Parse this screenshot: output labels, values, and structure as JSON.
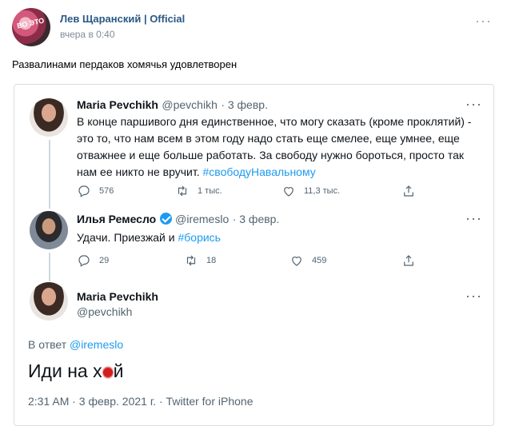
{
  "vk_post": {
    "author": "Лев Щаранский | Official",
    "time": "вчера в 0:40",
    "more": "···",
    "text": "Развалинами пердаков хомячья удовлетворен"
  },
  "thread": {
    "tweet1": {
      "name": "Maria Pevchikh",
      "handle": "@pevchikh",
      "date": "· 3 февр.",
      "text": "В конце паршивого дня единственное, что могу сказать (кроме проклятий) - это то, что нам всем в этом году надо стать еще смелее, еще умнее, еще отважнее и еще больше работать. За свободу нужно бороться, просто так нам ее никто не вручит.",
      "hashtag": "#свободуНавальному",
      "replies": "576",
      "retweets": "1 тыс.",
      "likes": "11,3 тыс."
    },
    "tweet2": {
      "name": "Илья Ремесло",
      "handle": "@iremeslo",
      "date": "· 3 февр.",
      "text": "Удачи. Приезжай и",
      "hashtag": "#борись",
      "replies": "29",
      "retweets": "18",
      "likes": "459"
    },
    "tweet3": {
      "name": "Maria Pevchikh",
      "handle": "@pevchikh",
      "reply_prefix": "В ответ",
      "reply_handle": "@iremeslo",
      "text_before": "Иди на х",
      "text_after": "й",
      "meta": "2:31 AM · 3 февр. 2021 г. · Twitter for iPhone"
    },
    "more": "···"
  },
  "icons": [
    "reply-icon",
    "retweet-icon",
    "like-icon",
    "share-icon",
    "verified-icon",
    "more-icon"
  ]
}
